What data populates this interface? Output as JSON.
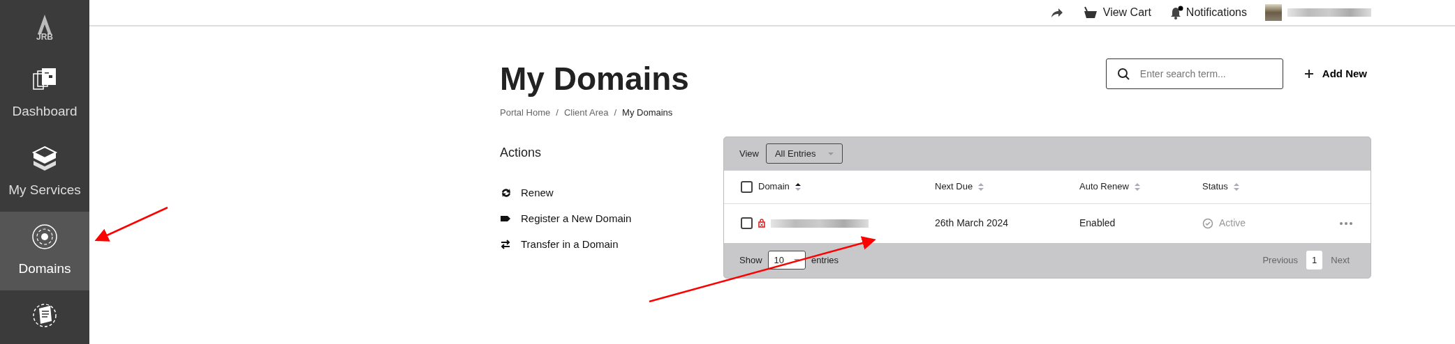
{
  "sidebar": {
    "logo": "JRB",
    "items": [
      {
        "label": "Dashboard",
        "selected": false
      },
      {
        "label": "My Services",
        "selected": false
      },
      {
        "label": "Domains",
        "selected": true
      },
      {
        "selected": false
      }
    ]
  },
  "topbar": {
    "cart": "View Cart",
    "notifications": "Notifications",
    "has_unread": true
  },
  "page": {
    "title": "My Domains",
    "breadcrumb": [
      {
        "label": "Portal Home",
        "current": false
      },
      {
        "label": "Client Area",
        "current": false
      },
      {
        "label": "My Domains",
        "current": true
      }
    ],
    "breadcrumb_separators": [
      "/",
      "/"
    ],
    "search": {
      "placeholder": "Enter search term..."
    },
    "add_button": "Add New"
  },
  "actions": {
    "title": "Actions",
    "items": [
      "Renew",
      "Register a New Domain",
      "Transfer in a Domain"
    ]
  },
  "table": {
    "view_label": "View",
    "view_value": "All Entries",
    "select_all_checked": false,
    "columns": [
      {
        "label": "Domain",
        "sorted": true
      },
      {
        "label": "Next Due",
        "sorted": false
      },
      {
        "label": "Auto Renew",
        "sorted": false
      },
      {
        "label": "Status",
        "sorted": false
      }
    ],
    "rows": [
      {
        "checked": false,
        "locked": true,
        "next_due": "26th March 2024",
        "auto_renew": "Enabled",
        "status": "Active"
      }
    ],
    "footer": {
      "show": "Show",
      "page_size": "10",
      "entries": "entries",
      "previous": "Previous",
      "pages": [
        {
          "label": "1",
          "selected": true
        }
      ],
      "next": "Next"
    }
  }
}
